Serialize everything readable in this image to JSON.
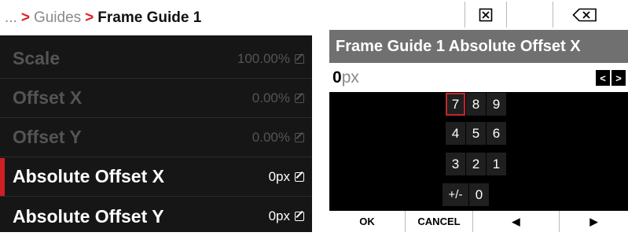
{
  "menu": {
    "breadcrumb": {
      "ellipsis": "...",
      "sep1": ">",
      "parent": "Guides",
      "sep2": ">",
      "current": "Frame Guide 1"
    },
    "items": [
      {
        "label": "Scale",
        "value": "100.00%",
        "state": "disabled"
      },
      {
        "label": "Offset X",
        "value": "0.00%",
        "state": "disabled"
      },
      {
        "label": "Offset Y",
        "value": "0.00%",
        "state": "disabled"
      },
      {
        "label": "Absolute Offset X",
        "value": "0px",
        "state": "selected"
      },
      {
        "label": "Absolute Offset Y",
        "value": "0px",
        "state": "enabled"
      }
    ]
  },
  "keypad_dialog": {
    "title": "Frame Guide 1 Absolute Offset X",
    "input": {
      "number": "0",
      "unit": "px"
    },
    "cursor_left": "<",
    "cursor_right": ">",
    "keys": [
      "7",
      "8",
      "9",
      "4",
      "5",
      "6",
      "3",
      "2",
      "1",
      "+/-",
      "0"
    ],
    "selected_key": "7",
    "buttons": {
      "ok": "OK",
      "cancel": "CANCEL",
      "left": "◀",
      "right": "▶"
    },
    "top_icons": [
      "clear-all-icon",
      "backspace-icon"
    ],
    "accent_color": "#d01f24"
  }
}
